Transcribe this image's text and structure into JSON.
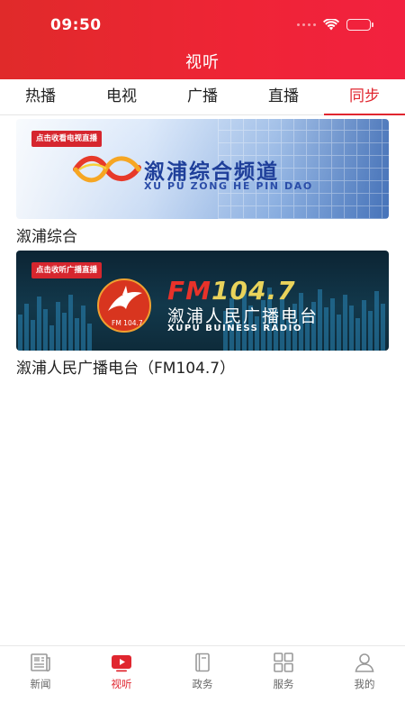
{
  "status_bar": {
    "time": "09:50"
  },
  "header": {
    "title": "视听"
  },
  "tabs": [
    {
      "label": "热播",
      "active": false
    },
    {
      "label": "电视",
      "active": false
    },
    {
      "label": "广播",
      "active": false
    },
    {
      "label": "直播",
      "active": false
    },
    {
      "label": "同步",
      "active": true
    }
  ],
  "channels": [
    {
      "tag": "点击收看电视直播",
      "banner_title": "溆浦综合频道",
      "banner_subtitle": "XU PU ZONG HE PIN DAO",
      "label": "溆浦综合"
    },
    {
      "tag": "点击收听广播直播",
      "fm_prefix": "FM",
      "fm_number": "104.7",
      "banner_title": "溆浦人民广播电台",
      "banner_subtitle": "XUPU BUINESS RADIO",
      "logo_text": "FM 104.7",
      "label": "溆浦人民广播电台（FM104.7）"
    }
  ],
  "bottom_nav": [
    {
      "label": "新闻",
      "icon": "newspaper-icon",
      "active": false
    },
    {
      "label": "视听",
      "icon": "play-video-icon",
      "active": true
    },
    {
      "label": "政务",
      "icon": "book-icon",
      "active": false
    },
    {
      "label": "服务",
      "icon": "grid-icon",
      "active": false
    },
    {
      "label": "我的",
      "icon": "user-icon",
      "active": false
    }
  ],
  "colors": {
    "brand_red": "#e0262f",
    "header_gradient_start": "#e02a2a",
    "header_gradient_end": "#f2213f",
    "inactive_gray": "#666666"
  }
}
